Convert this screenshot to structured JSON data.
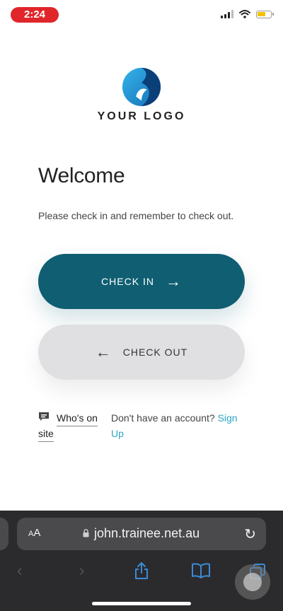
{
  "status_bar": {
    "time": "2:24"
  },
  "logo": {
    "text": "YOUR LOGO",
    "colors": {
      "light": "#2a9fd8",
      "dark": "#0b3f78"
    }
  },
  "welcome": {
    "title": "Welcome",
    "subtitle": "Please check in and remember to check out."
  },
  "buttons": {
    "check_in": {
      "label": "CHECK IN",
      "icon": "arrow-right-icon",
      "color": "#0f5e72"
    },
    "check_out": {
      "label": "CHECK OUT",
      "icon": "arrow-left-icon",
      "color": "#e0e0e2"
    }
  },
  "links": {
    "whos_on_site_line1": "Who's on",
    "whos_on_site_line2": "site",
    "account_prompt": "Don't have an account?",
    "signup_line1": "Sign",
    "signup_line2": "Up"
  },
  "browser": {
    "text_size_label": "AA",
    "url": "john.trainee.net.au",
    "icons": [
      "back-icon",
      "forward-icon",
      "share-icon",
      "bookmarks-icon",
      "tabs-icon",
      "reload-icon",
      "lock-icon"
    ]
  }
}
